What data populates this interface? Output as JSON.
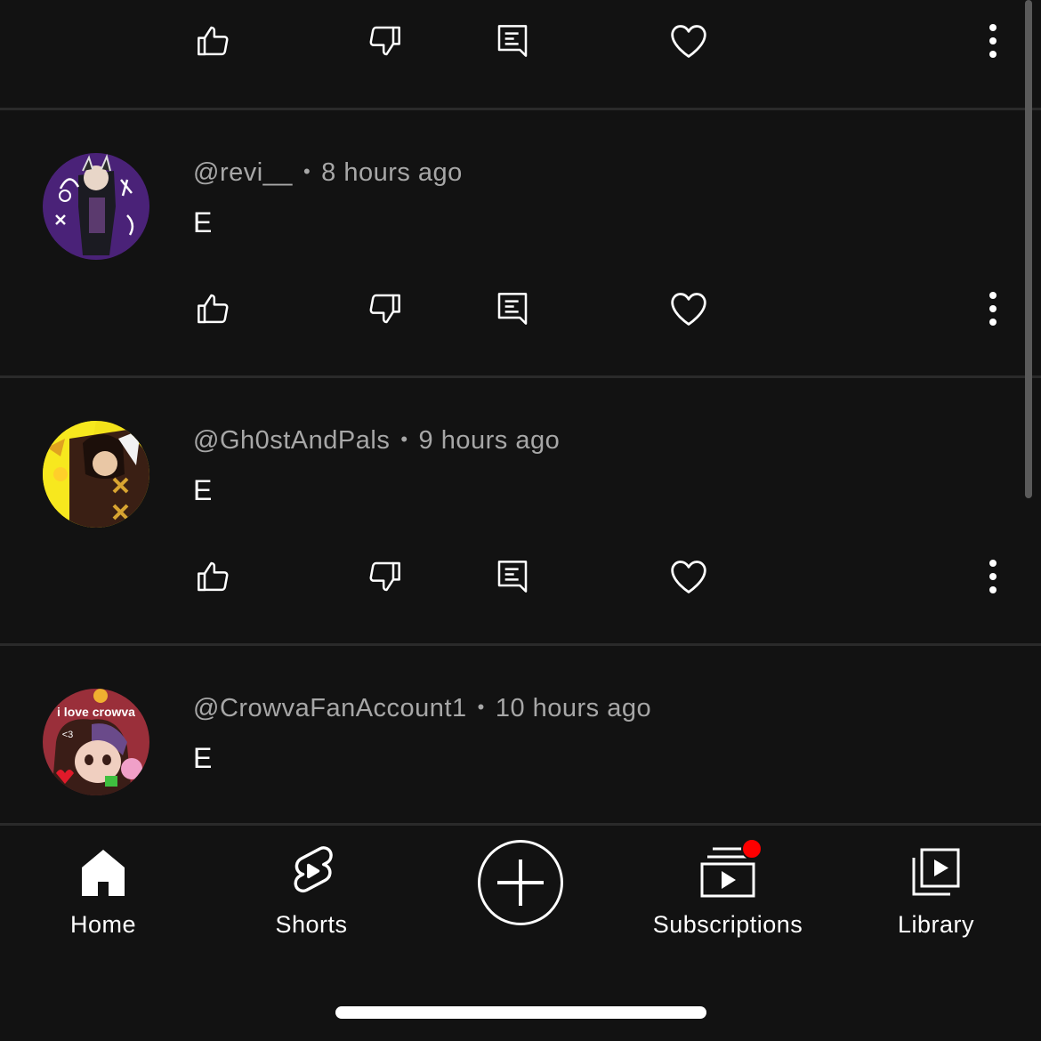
{
  "colors": {
    "background": "#121212",
    "divider": "#2a2a2a",
    "meta_text": "#a7a7a7",
    "notification": "#ff0000"
  },
  "comments": [
    {
      "author": "@revi__",
      "time": "8 hours ago",
      "text": "E"
    },
    {
      "author": "@Gh0stAndPals",
      "time": "9 hours ago",
      "text": "E"
    },
    {
      "author": "@CrowvaFanAccount1",
      "time": "10 hours ago",
      "text": "E",
      "avatar_text": [
        "i love crowva",
        "<3"
      ]
    }
  ],
  "separator": "•",
  "actions_icons": [
    "thumbs-up-icon",
    "thumbs-down-icon",
    "reply-icon",
    "heart-icon",
    "more-vertical-icon"
  ],
  "bottom_nav": {
    "home": "Home",
    "shorts": "Shorts",
    "create_icon": "plus-icon",
    "subscriptions": "Subscriptions",
    "library": "Library"
  }
}
